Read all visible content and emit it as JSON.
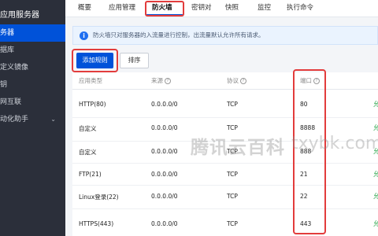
{
  "sidebar": {
    "title": "应用服务器",
    "items": [
      {
        "label": "务器",
        "active": true
      },
      {
        "label": "据库",
        "active": false
      },
      {
        "label": "定义镜像",
        "active": false
      },
      {
        "label": "钥",
        "active": false
      },
      {
        "label": "网互联",
        "active": false
      },
      {
        "label": "动化助手",
        "active": false,
        "expandable": true
      }
    ]
  },
  "tabs": [
    {
      "label": "概要"
    },
    {
      "label": "应用管理"
    },
    {
      "label": "防火墙",
      "active": true
    },
    {
      "label": "密钥对"
    },
    {
      "label": "快照"
    },
    {
      "label": "监控"
    },
    {
      "label": "执行命令"
    }
  ],
  "notice": {
    "icon": "info-icon",
    "text": "防火墙只对服务器的入流量进行控制，出流量默认允许所有请求。"
  },
  "toolbar": {
    "add_label": "添加规则",
    "sort_label": "排序"
  },
  "table": {
    "columns": [
      "应用类型",
      "来源",
      "协议",
      "端口"
    ],
    "rows": [
      {
        "app_type": "HTTP(80)",
        "source": "0.0.0.0/0",
        "protocol": "TCP",
        "port": "80"
      },
      {
        "app_type": "自定义",
        "source": "0.0.0.0/0",
        "protocol": "TCP",
        "port": "8888"
      },
      {
        "app_type": "自定义",
        "source": "0.0.0.0/0",
        "protocol": "TCP",
        "port": "888"
      },
      {
        "app_type": "FTP(21)",
        "source": "0.0.0.0/0",
        "protocol": "TCP",
        "port": "21"
      },
      {
        "app_type": "Linux登录(22)",
        "source": "0.0.0.0/0",
        "protocol": "TCP",
        "port": "22"
      },
      {
        "app_type": "HTTPS(443)",
        "source": "0.0.0.0/0",
        "protocol": "TCP",
        "port": "443"
      }
    ],
    "status_glyph": "允"
  },
  "watermark": {
    "text": "腾讯云百科",
    "domain": "txybk.com"
  },
  "colors": {
    "accent": "#0052d9",
    "highlight_box": "#e23c3c",
    "sidebar_bg": "#2b2f3a",
    "status_green": "#2aa54a"
  }
}
